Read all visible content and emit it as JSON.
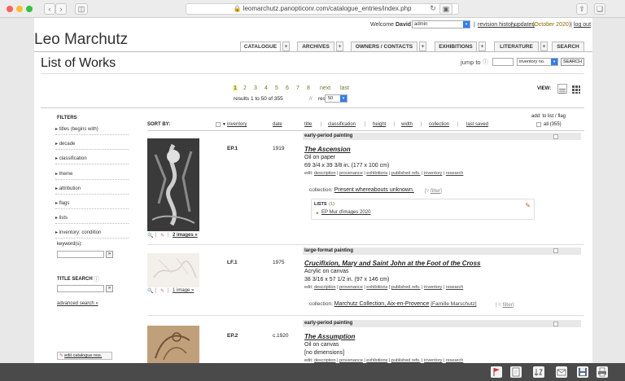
{
  "browser": {
    "url": "leomarchutz.panopticonr.com/catalogue_entries/index.php"
  },
  "topbar": {
    "welcome": "Welcome",
    "user": "David",
    "role_select": "admin",
    "revision_history": "revision history",
    "updates": "updates",
    "updates_date": "(October 2020)",
    "logout": "log out"
  },
  "site_title": "Leo Marchutz",
  "nav": {
    "tabs": [
      "CATALOGUE",
      "ARCHIVES",
      "OWNERS / CONTACTS",
      "EXHIBITIONS",
      "LITERATURE",
      "SEARCH"
    ],
    "plus": "+"
  },
  "page_title": "List of Works",
  "jump": {
    "label": "jump to",
    "select": "inventory no.",
    "button": "SEARCH"
  },
  "view": {
    "label": "VIEW:"
  },
  "pager": {
    "pages": [
      "1",
      "2",
      "3",
      "4",
      "5",
      "6",
      "7",
      "8"
    ],
    "next": "next",
    "last": "last",
    "results": "results 1 to 50 of 355",
    "sep": "//",
    "results_label": "results:",
    "per_page": "50"
  },
  "add": {
    "line1": "add: to list / flag",
    "all": "all (355)"
  },
  "filters": {
    "heading": "FILTERS",
    "items": [
      "titles (begins with)",
      "decade",
      "classification",
      "theme",
      "attribution",
      "flags",
      "lists",
      "inventory: condition"
    ],
    "keyword_label": "keyword(s):",
    "go": "»",
    "title_search": "TITLE SEARCH",
    "advanced": "advanced search »",
    "edit_nos": "edit catalogue nos."
  },
  "sort": {
    "label": "SORT BY:",
    "cols": [
      "inventory",
      "date",
      "title",
      "classification",
      "height",
      "width",
      "collection",
      "last saved"
    ],
    "seps": [
      "|",
      "|",
      "|",
      "|",
      "|"
    ]
  },
  "entries": [
    {
      "band": "early-period painting",
      "inv": "EP.1",
      "date": "1919",
      "title": "The Ascension",
      "medium": "Oil on paper",
      "dims": "69 3/4 x 39 3/8 in. (177 x 100 cm)",
      "edit": [
        "edit:",
        "description",
        "provenance",
        "exhibitions",
        "published refs.",
        "inventory",
        "research"
      ],
      "collection_label": "collection:",
      "collection": "Present whereabouts unknown.",
      "filter": "filter",
      "lists_label": "LISTS",
      "lists_count": "(1):",
      "list_item": "EP Mur d'images 2020",
      "images": "2 images »"
    },
    {
      "band": "large-format painting",
      "inv": "LF.1",
      "date": "1975",
      "title": "Crucifixion, Mary and Saint John at the Foot of the Cross",
      "medium": "Acrylic on canvas",
      "dims": "38 3/16 x 57 1/2 in. (97 x 146 cm)",
      "edit": [
        "edit:",
        "description",
        "provenance",
        "exhibitions",
        "published refs.",
        "inventory",
        "research"
      ],
      "collection_label": "collection:",
      "collection": "Marchutz Collection, Aix-en-Provence",
      "collection_extra": "[Famille Marschutz]",
      "filter": "filter",
      "images": "1 image »"
    },
    {
      "band": "early-period painting",
      "inv": "EP.2",
      "date": "c.1920",
      "title": "The Assumption",
      "medium": "Oil on canvas",
      "dims": "[no dimensions]",
      "edit": [
        "edit:",
        "description",
        "provenance",
        "exhibitions",
        "published refs.",
        "inventory",
        "research"
      ]
    }
  ],
  "colors": {
    "accent": "#6a7a2a",
    "band": "#e8e8e8",
    "select_blue": "#2f7df6"
  }
}
